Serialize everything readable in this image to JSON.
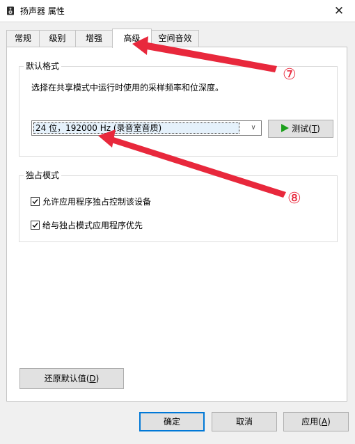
{
  "window": {
    "title": "扬声器 属性",
    "close_glyph": "✕"
  },
  "tabs": [
    {
      "label": "常规"
    },
    {
      "label": "级别"
    },
    {
      "label": "增强"
    },
    {
      "label": "高级",
      "active": true
    },
    {
      "label": "空间音效"
    }
  ],
  "default_format": {
    "group_title": "默认格式",
    "description": "选择在共享模式中运行时使用的采样频率和位深度。",
    "selected_value": "24 位，192000 Hz (录音室音质)",
    "test_button": {
      "label": "测试(",
      "accel": "T",
      "suffix": ")"
    }
  },
  "exclusive_mode": {
    "group_title": "独占模式",
    "options": [
      {
        "label": "允许应用程序独占控制该设备",
        "checked": true
      },
      {
        "label": "给与独占模式应用程序优先",
        "checked": true
      }
    ]
  },
  "restore_button": {
    "label": "还原默认值(",
    "accel": "D",
    "suffix": ")"
  },
  "footer": {
    "ok_label": "确定",
    "cancel_label": "取消",
    "apply": {
      "label": "应用(",
      "accel": "A",
      "suffix": ")"
    }
  },
  "annotations": {
    "marker_7": "⑦",
    "marker_8": "⑧",
    "arrow_color": "#e8283c"
  }
}
